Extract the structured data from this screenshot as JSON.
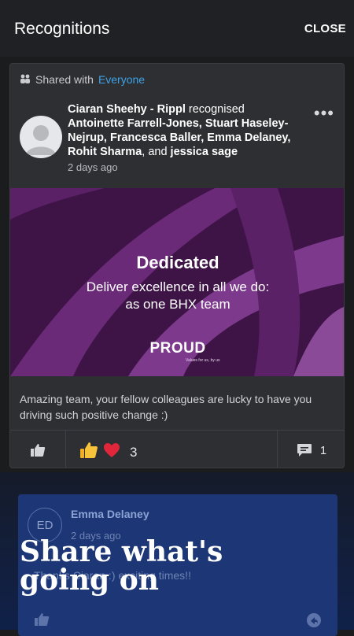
{
  "header": {
    "title": "Recognitions",
    "close_label": "CLOSE"
  },
  "post": {
    "shared_prefix": "Shared with",
    "shared_audience": "Everyone",
    "author": "Ciaran Sheehy - Rippl",
    "verb": "recognised",
    "recipients_a": "Antoinette Farrell-Jones, Stuart Haseley-Nejrup, Francesca Baller, Emma Delaney, Rohit Sharma",
    "recipients_joiner": ", and",
    "recipients_b": "jessica sage",
    "time": "2 days ago",
    "banner": {
      "title": "Dedicated",
      "line1": "Deliver excellence in all we do:",
      "line2": "as one BHX team",
      "logo": "PROUD",
      "logo_sub": "Values for us, by us"
    },
    "comment": "Amazing team, your fellow colleagues are lucky to have you driving such positive change :)",
    "reaction_count": "3",
    "comment_count": "1"
  },
  "reply": {
    "initials": "ED",
    "name": "Emma Delaney",
    "time": "2 days ago",
    "text": "Thanks Ciaran :) exciting times!!"
  },
  "overlay": {
    "line1": "Share what's",
    "line2": "going on"
  },
  "colors": {
    "accent": "#3ea3e6",
    "banner": "#3e1446",
    "reply_bg": "#1d3776"
  }
}
